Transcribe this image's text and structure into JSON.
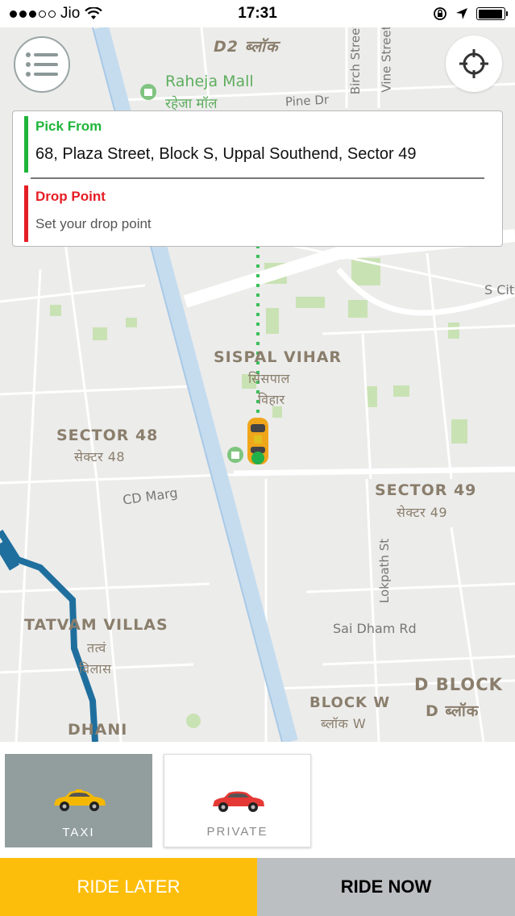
{
  "status_bar": {
    "carrier": "Jio",
    "time": "17:31",
    "battery_level": 0.95
  },
  "map": {
    "labels": {
      "d2_block": "D2 ब्लॉक",
      "raheja_mall": "Raheja Mall",
      "raheja_mall_hi": "रहेजा मॉल",
      "pine_dr": "Pine Dr",
      "birch_street": "Birch Street",
      "vine_street": "Vine Street",
      "s_city": "S Cit",
      "sispal_vihar": "SISPAL VIHAR",
      "sispal_vihar_hi_1": "सिसपाल",
      "sispal_vihar_hi_2": "विहार",
      "sector_48": "SECTOR 48",
      "sector_48_hi": "सेक्टर 48",
      "cd_marg": "CD Marg",
      "sector_49": "SECTOR 49",
      "sector_49_hi": "सेक्टर 49",
      "lokpath_st": "Lokpath St",
      "sai_dham_rd": "Sai Dham Rd",
      "tatvam_villas": "TATVAM VILLAS",
      "tatvam_villas_hi_1": "तत्वं",
      "tatvam_villas_hi_2": "विलास",
      "d_block": "D BLOCK",
      "d_block_hi": "D ब्लॉक",
      "block_w": "BLOCK W",
      "block_w_hi": "ब्लॉक W",
      "dhani": "DHANI"
    },
    "menu_icon": "hamburger-menu-icon",
    "locate_icon": "crosshair-locate-icon"
  },
  "address_card": {
    "pick_title": "Pick From",
    "pick_address": "68, Plaza Street, Block S, Uppal Southend, Sector 49",
    "drop_title": "Drop Point",
    "drop_placeholder": "Set your drop point",
    "pick_color": "#1fb53a",
    "drop_color": "#e51e25"
  },
  "vehicles": [
    {
      "label": "TAXI",
      "selected": true,
      "icon": "taxi-car-icon",
      "color": "#f5b800"
    },
    {
      "label": "PRIVATE",
      "selected": false,
      "icon": "private-car-icon",
      "color": "#e53935"
    }
  ],
  "actions": {
    "ride_later": "RIDE LATER",
    "ride_now": "RIDE NOW"
  }
}
